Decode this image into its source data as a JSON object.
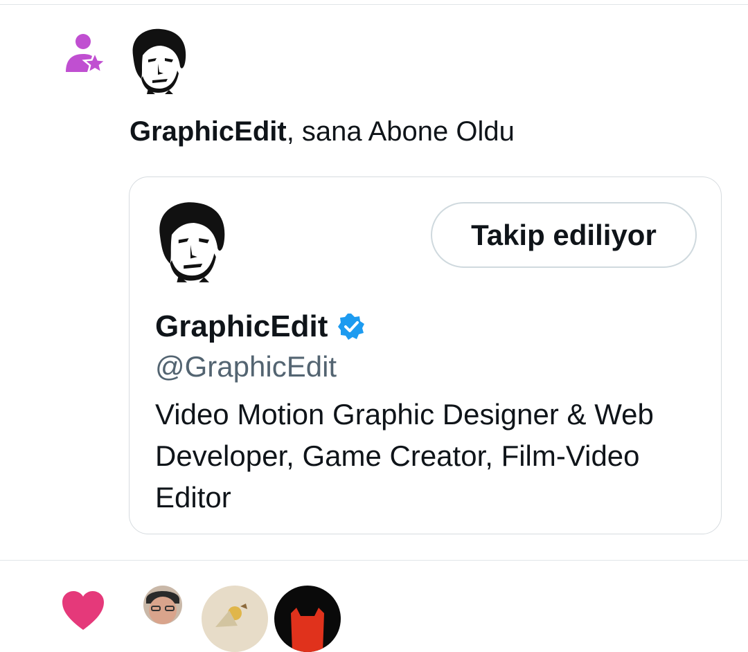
{
  "notification": {
    "type_icon": "person-star-icon",
    "type_color": "#c04fd1",
    "actor_name": "GraphicEdit",
    "action_text": ", sana Abone Oldu"
  },
  "profile_card": {
    "display_name": "GraphicEdit",
    "verified_icon": "verified-badge-icon",
    "verified_color": "#1d9bf0",
    "handle": "@GraphicEdit",
    "follow_button_label": "Takip ediliyor",
    "bio": "Video Motion Graphic Designer & Web Developer, Game Creator, Film-Video Editor"
  },
  "next_notification": {
    "type_icon": "heart-icon",
    "type_color": "#e5397a"
  }
}
